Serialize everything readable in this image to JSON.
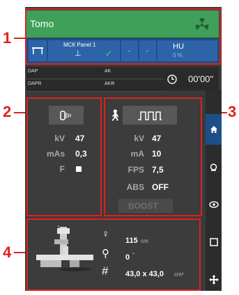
{
  "callouts": [
    "1",
    "2",
    "3",
    "4"
  ],
  "header": {
    "mode": "Tomo",
    "radiation_icon": "radiation-icon"
  },
  "device_bar": {
    "panel_name": "МСК Panel 1",
    "cell2": "-",
    "cell3": "-",
    "hu_label": "HU",
    "hu_value": "0 %"
  },
  "dose": {
    "dap_label": "DAP",
    "ak_label": "AK",
    "dapr_label": "DAPR",
    "akr_label": "AKR"
  },
  "timer": {
    "value": "00'00''"
  },
  "left_panel": {
    "kv_label": "kV",
    "kv_value": "47",
    "mas_label": "mAs",
    "mas_value": "0,3",
    "f_label": "F"
  },
  "right_panel": {
    "kv_label": "kV",
    "kv_value": "47",
    "ma_label": "mA",
    "ma_value": "10",
    "fps_label": "FPS",
    "fps_value": "7,5",
    "abs_label": "ABS",
    "abs_value": "OFF",
    "boost_label": "BOOST"
  },
  "geometry_panel": {
    "table_index": "1",
    "sid_value": "115",
    "sid_unit": "cm",
    "angle_value": "0",
    "angle_unit": "°",
    "field_value": "43,0 x 43,0",
    "field_unit": "cm²"
  },
  "colors": {
    "accent_green": "#3fa05a",
    "accent_blue": "#1f4f88",
    "callout_red": "#e02020"
  }
}
